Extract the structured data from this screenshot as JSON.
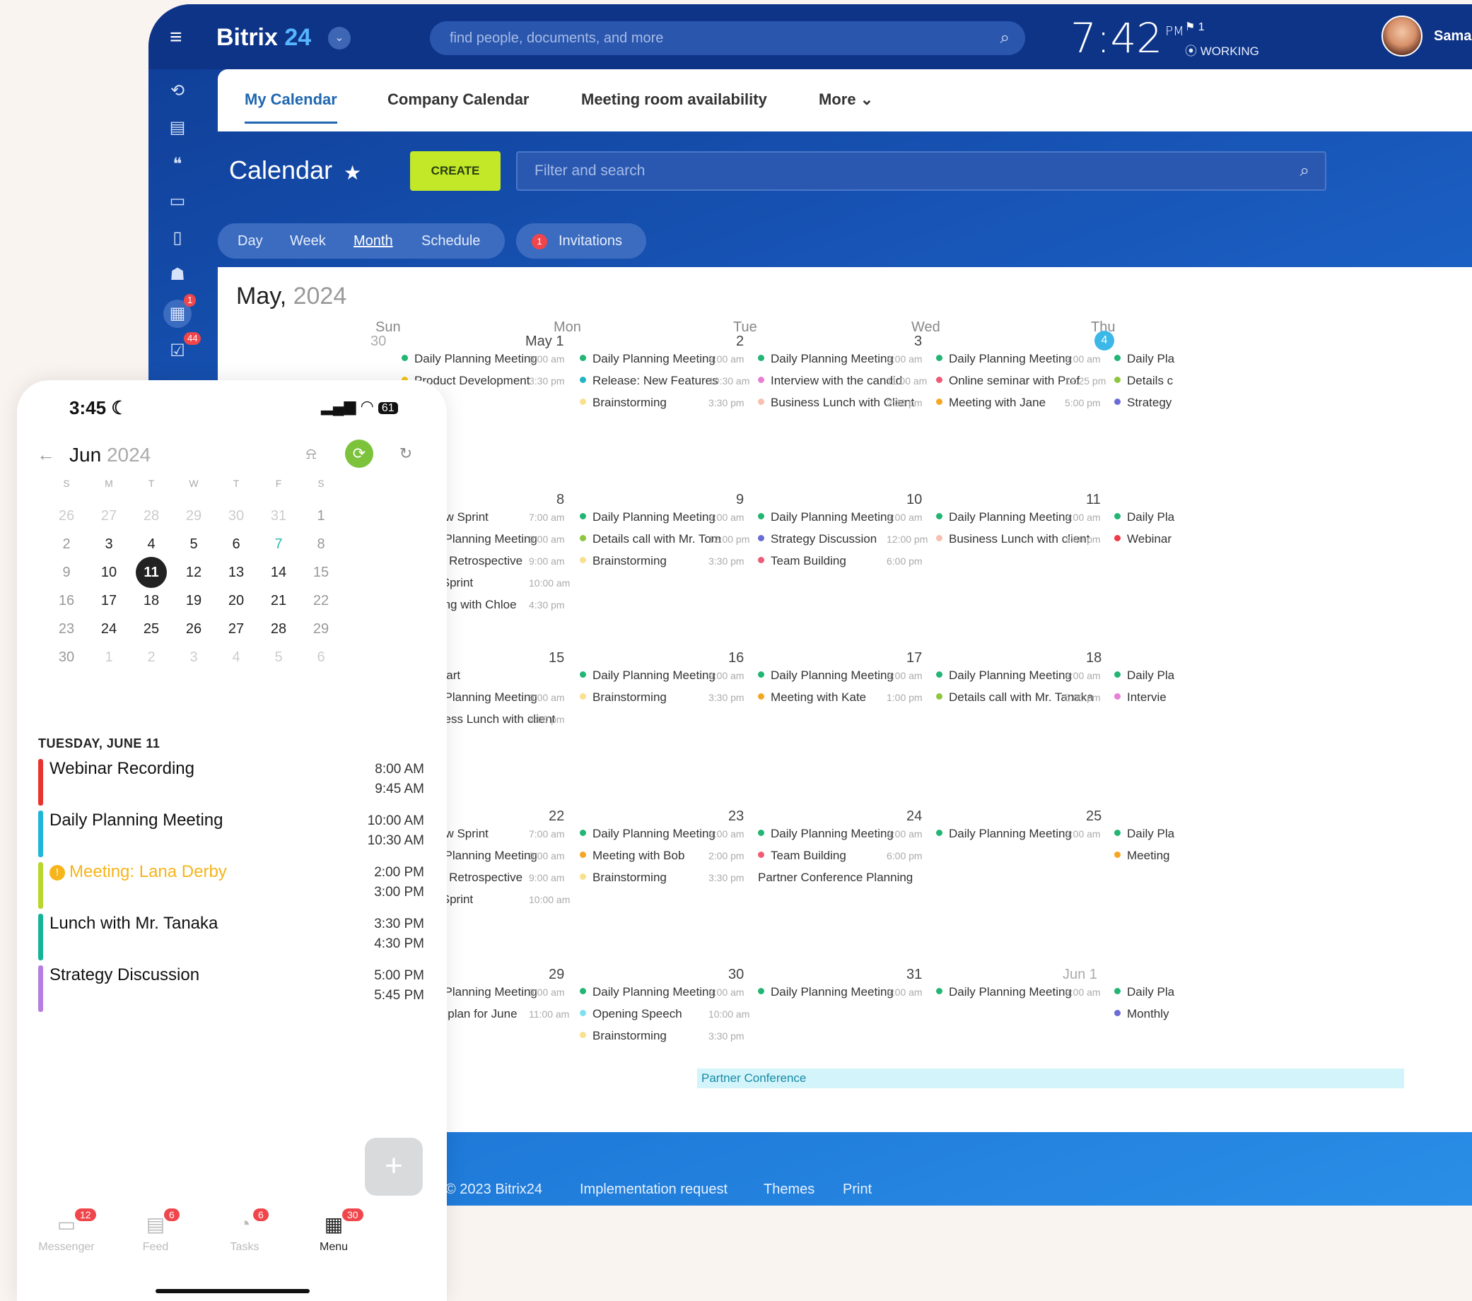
{
  "app": {
    "logo_name": "Bitrix",
    "logo_num": "24",
    "search_placeholder": "find people, documents, and more",
    "time": "7:42",
    "ampm": "PM",
    "flag": "1",
    "status": "WORKING",
    "user": "Sama"
  },
  "tabs": [
    {
      "label": "My Calendar"
    },
    {
      "label": "Company Calendar"
    },
    {
      "label": "Meeting room availability"
    },
    {
      "label": "More"
    }
  ],
  "calendar": {
    "title": "Calendar",
    "create": "CREATE",
    "filter_placeholder": "Filter and search",
    "views": [
      "Day",
      "Week",
      "Month",
      "Schedule"
    ],
    "invitations": "Invitations",
    "invitations_count": "1",
    "month": "May,",
    "year": "2024",
    "dow": [
      "Sun",
      "Mon",
      "Tue",
      "Wed",
      "Thu"
    ],
    "weeks": [
      {
        "nums": [
          "30",
          "May 1",
          "2",
          "3",
          "4"
        ],
        "events": [
          [
            {
              "t": "Daily Planning Meeting",
              "c": "#22b573",
              "time": "9:00 am"
            },
            {
              "t": "Product Development",
              "c": "#f5c518",
              "time": "3:30 pm"
            }
          ],
          [
            {
              "t": "Daily Planning Meeting",
              "c": "#22b573",
              "time": "9:00 am"
            },
            {
              "t": "Release: New Features",
              "c": "#22b5c4",
              "time": "10:30 am"
            },
            {
              "t": "Brainstorming",
              "c": "#f8e08e",
              "time": "3:30 pm"
            }
          ],
          [
            {
              "t": "Daily Planning Meeting",
              "c": "#22b573",
              "time": "9:00 am"
            },
            {
              "t": "Interview with the candid",
              "c": "#e87fd6",
              "time": "11:00 am"
            },
            {
              "t": "Business Lunch with Client",
              "c": "#f5c0b0",
              "time": "2:30 pm"
            }
          ],
          [
            {
              "t": "Daily Planning Meeting",
              "c": "#22b573",
              "time": "9:00 am"
            },
            {
              "t": "Online seminar with Prof",
              "c": "#ef5a74",
              "time": "12:25 pm"
            },
            {
              "t": "Meeting with Jane",
              "c": "#f5a623",
              "time": "5:00 pm"
            }
          ],
          [
            {
              "t": "Daily Pla",
              "c": "#22b573"
            },
            {
              "t": "Details c",
              "c": "#8fc63f"
            },
            {
              "t": "Strategy",
              "c": "#6b6bd6"
            }
          ]
        ]
      },
      {
        "nums": [
          "",
          "8",
          "9",
          "10",
          "11"
        ],
        "events": [
          [
            {
              "t": "Review Sprint",
              "c": "#ef5a5a",
              "time": "7:00 am",
              "badge": "!"
            },
            {
              "t": "Daily Planning Meeting",
              "c": "#22b573",
              "time": "9:00 am"
            },
            {
              "t": "Sprint Retrospective",
              "c": "#ef5a74",
              "time": "9:00 am"
            },
            {
              "t": "Plan Sprint",
              "c": "#e87fd6",
              "time": "10:00 am"
            },
            {
              "t": "Meeting with Chloe",
              "c": "#f5c518",
              "time": "4:30 pm"
            }
          ],
          [
            {
              "t": "Daily Planning Meeting",
              "c": "#22b573",
              "time": "9:00 am"
            },
            {
              "t": "Details call with Mr. Tom",
              "c": "#8fc63f",
              "time": "12:00 pm"
            },
            {
              "t": "Brainstorming",
              "c": "#f8e08e",
              "time": "3:30 pm"
            }
          ],
          [
            {
              "t": "Daily Planning Meeting",
              "c": "#22b573",
              "time": "9:00 am"
            },
            {
              "t": "Strategy Discussion",
              "c": "#6b6bd6",
              "time": "12:00 pm"
            },
            {
              "t": "Team Building",
              "c": "#ef5a74",
              "time": "6:00 pm"
            }
          ],
          [
            {
              "t": "Daily Planning Meeting",
              "c": "#22b573",
              "time": "9:00 am"
            },
            {
              "t": "Business Lunch with client",
              "c": "#f5c0b0",
              "time": "3:00 pm"
            }
          ],
          [
            {
              "t": "Daily Pla",
              "c": "#22b573"
            },
            {
              "t": "Webinar",
              "c": "#ef3a4a"
            }
          ]
        ]
      },
      {
        "nums": [
          "",
          "15",
          "16",
          "17",
          "18"
        ],
        "events": [
          [
            {
              "t": "Sales Start",
              "c": "",
              "time": ""
            },
            {
              "t": "Daily Planning Meeting",
              "c": "#22b573",
              "time": "9:00 am"
            },
            {
              "t": "Business Lunch with client",
              "c": "#f5c0b0",
              "time": "4:00 pm"
            }
          ],
          [
            {
              "t": "Daily Planning Meeting",
              "c": "#22b573",
              "time": "9:00 am"
            },
            {
              "t": "Brainstorming",
              "c": "#f8e08e",
              "time": "3:30 pm"
            }
          ],
          [
            {
              "t": "Daily Planning Meeting",
              "c": "#22b573",
              "time": "9:00 am"
            },
            {
              "t": "Meeting with Kate",
              "c": "#f5a623",
              "time": "1:00 pm"
            }
          ],
          [
            {
              "t": "Daily Planning Meeting",
              "c": "#22b573",
              "time": "9:00 am"
            },
            {
              "t": "Details call with Mr. Tanaka",
              "c": "#8fc63f",
              "time": "5:00 pm"
            }
          ],
          [
            {
              "t": "Daily Pla",
              "c": "#22b573"
            },
            {
              "t": "Intervie",
              "c": "#e87fd6"
            }
          ]
        ]
      },
      {
        "nums": [
          "",
          "22",
          "23",
          "24",
          "25"
        ],
        "events": [
          [
            {
              "t": "Review Sprint",
              "c": "#ef5a5a",
              "time": "7:00 am"
            },
            {
              "t": "Daily Planning Meeting",
              "c": "#22b573",
              "time": "9:00 am"
            },
            {
              "t": "Sprint Retrospective",
              "c": "#ef5a74",
              "time": "9:00 am"
            },
            {
              "t": "Plan Sprint",
              "c": "#e87fd6",
              "time": "10:00 am"
            }
          ],
          [
            {
              "t": "Daily Planning Meeting",
              "c": "#22b573",
              "time": "9:00 am"
            },
            {
              "t": "Meeting with Bob",
              "c": "#f5a623",
              "time": "2:00 pm"
            },
            {
              "t": "Brainstorming",
              "c": "#f8e08e",
              "time": "3:30 pm"
            }
          ],
          [
            {
              "t": "Daily Planning Meeting",
              "c": "#22b573",
              "time": "9:00 am"
            },
            {
              "t": "Team Building",
              "c": "#ef5a74",
              "time": "6:00 pm"
            },
            {
              "t": "Partner Conference Planning",
              "c": ""
            }
          ],
          [
            {
              "t": "Daily Planning Meeting",
              "c": "#22b573",
              "time": "9:00 am"
            }
          ],
          [
            {
              "t": "Daily Pla",
              "c": "#22b573"
            },
            {
              "t": "Meeting",
              "c": "#f5a623"
            }
          ]
        ]
      },
      {
        "nums": [
          "",
          "29",
          "30",
          "31",
          "Jun 1"
        ],
        "events": [
          [
            {
              "t": "Daily Planning Meeting",
              "c": "#22b573",
              "time": "9:00 am"
            },
            {
              "t": "Sales plan for June",
              "c": "#6b6bd6",
              "time": "11:00 am"
            }
          ],
          [
            {
              "t": "Daily Planning Meeting",
              "c": "#22b573",
              "time": "9:00 am"
            },
            {
              "t": "Opening Speech",
              "c": "#7fe0f0",
              "time": "10:00 am"
            },
            {
              "t": "Brainstorming",
              "c": "#f8e08e",
              "time": "3:30 pm"
            }
          ],
          [
            {
              "t": "Daily Planning Meeting",
              "c": "#22b573",
              "time": "9:00 am"
            }
          ],
          [
            {
              "t": "Daily Planning Meeting",
              "c": "#22b573",
              "time": "9:00 am"
            }
          ],
          [
            {
              "t": "Daily Pla",
              "c": "#22b573"
            },
            {
              "t": "Monthly",
              "c": "#6b6bd6"
            }
          ]
        ]
      }
    ],
    "conference": "Partner Conference"
  },
  "footer": [
    "© 2023 Bitrix24",
    "Implementation request",
    "Themes",
    "Print"
  ],
  "phone": {
    "time": "3:45",
    "battery": "61",
    "month": "Jun",
    "year": "2024",
    "dow": [
      "S",
      "M",
      "T",
      "W",
      "T",
      "F",
      "S"
    ],
    "days": [
      [
        "26",
        "27",
        "28",
        "29",
        "30",
        "31",
        "1"
      ],
      [
        "2",
        "3",
        "4",
        "5",
        "6",
        "7",
        "8"
      ],
      [
        "9",
        "10",
        "11",
        "12",
        "13",
        "14",
        "15"
      ],
      [
        "16",
        "17",
        "18",
        "19",
        "20",
        "21",
        "22"
      ],
      [
        "23",
        "24",
        "25",
        "26",
        "27",
        "28",
        "29"
      ],
      [
        "30",
        "1",
        "2",
        "3",
        "4",
        "5",
        "6"
      ]
    ],
    "date_heading": "TUESDAY, JUNE 11",
    "events": [
      {
        "title": "Webinar Recording",
        "start": "8:00 AM",
        "end": "9:45 AM",
        "color": "#e8332f",
        "text_color": "#111"
      },
      {
        "title": "Daily Planning Meeting",
        "start": "10:00 AM",
        "end": "10:30 AM",
        "color": "#1fb6d8",
        "text_color": "#111"
      },
      {
        "title": "Meeting: Lana Derby",
        "start": "2:00 PM",
        "end": "3:00 PM",
        "color": "#b8d62c",
        "text_color": "#f5b51b"
      },
      {
        "title": "Lunch with Mr. Tanaka",
        "start": "3:30 PM",
        "end": "4:30 PM",
        "color": "#16b39b",
        "text_color": "#111"
      },
      {
        "title": "Strategy Discussion",
        "start": "5:00 PM",
        "end": "5:45 PM",
        "color": "#b57ee0",
        "text_color": "#111"
      }
    ],
    "nav": [
      {
        "label": "Messenger",
        "count": "12"
      },
      {
        "label": "Feed",
        "count": "6"
      },
      {
        "label": "Tasks",
        "count": "6"
      },
      {
        "label": "Menu",
        "count": "30"
      }
    ]
  }
}
